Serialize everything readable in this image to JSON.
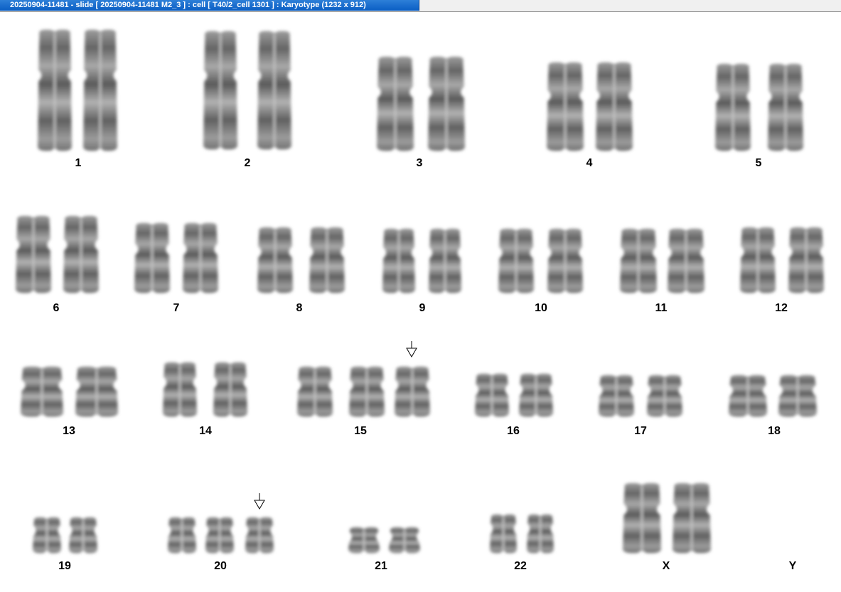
{
  "window": {
    "title": "20250904-11481 - slide [ 20250904-11481 M2_3 ] : cell [ T40/2_cell 1301 ] : Karyotype  (1232 x 912)"
  },
  "karyotype": {
    "groups": [
      {
        "label": "1",
        "count": 2
      },
      {
        "label": "2",
        "count": 2
      },
      {
        "label": "3",
        "count": 2
      },
      {
        "label": "4",
        "count": 2
      },
      {
        "label": "5",
        "count": 2
      },
      {
        "label": "6",
        "count": 2
      },
      {
        "label": "7",
        "count": 2
      },
      {
        "label": "8",
        "count": 2
      },
      {
        "label": "9",
        "count": 2
      },
      {
        "label": "10",
        "count": 2
      },
      {
        "label": "11",
        "count": 2
      },
      {
        "label": "12",
        "count": 2
      },
      {
        "label": "13",
        "count": 2
      },
      {
        "label": "14",
        "count": 2
      },
      {
        "label": "15",
        "count": 3,
        "marked": true
      },
      {
        "label": "16",
        "count": 2
      },
      {
        "label": "17",
        "count": 2
      },
      {
        "label": "18",
        "count": 2
      },
      {
        "label": "19",
        "count": 2
      },
      {
        "label": "20",
        "count": 3,
        "marked": true
      },
      {
        "label": "21",
        "count": 2
      },
      {
        "label": "22",
        "count": 2
      },
      {
        "label": "X",
        "count": 2
      },
      {
        "label": "Y",
        "count": 0
      }
    ]
  },
  "colors": {
    "chromosome_dark": "#3a3a3a",
    "chromosome_light": "#9a9a9a",
    "title_bar": "#0a5ec4"
  }
}
